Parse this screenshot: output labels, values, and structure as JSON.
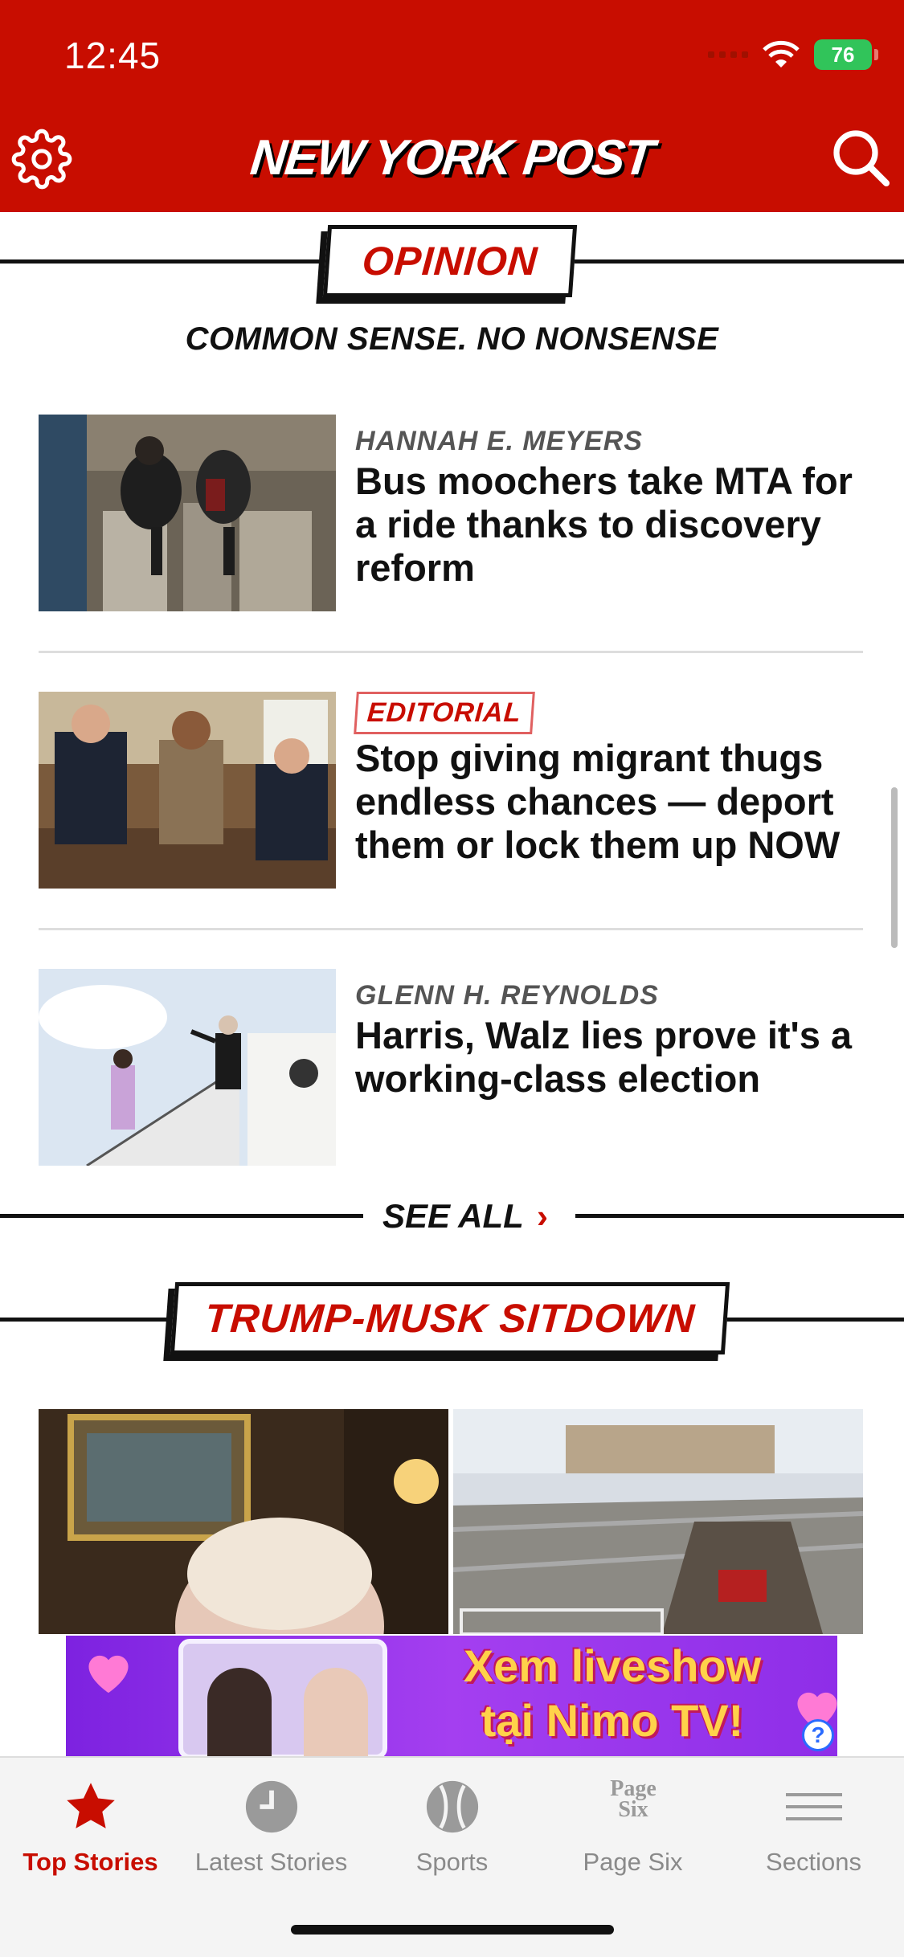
{
  "status_bar": {
    "time": "12:45",
    "battery": "76"
  },
  "header": {
    "logo": "NEW YORK POST",
    "brand_color": "#c80d00"
  },
  "opinion": {
    "title": "OPINION",
    "tagline": "COMMON SENSE. NO NONSENSE",
    "stories": [
      {
        "byline": "HANNAH E. MEYERS",
        "headline": "Bus moochers take MTA for a ride thanks to discovery reform"
      },
      {
        "badge": "EDITORIAL",
        "headline": "Stop giving migrant thugs endless chances — deport them or lock them up NOW"
      },
      {
        "byline": "GLENN H. REYNOLDS",
        "headline": "Harris, Walz lies prove it's a working-class election"
      }
    ],
    "see_all": "SEE ALL"
  },
  "trump_musk": {
    "title": "TRUMP-MUSK SITDOWN"
  },
  "ad": {
    "text_line1": "Xem liveshow",
    "text_line2": "tại Nimo TV!",
    "help": "?"
  },
  "tabbar": {
    "tabs": [
      {
        "label": "Top Stories",
        "icon": "star-icon",
        "active": true
      },
      {
        "label": "Latest Stories",
        "icon": "clock-icon"
      },
      {
        "label": "Sports",
        "icon": "baseball-icon"
      },
      {
        "label": "Page Six",
        "icon": "page-six-icon",
        "icon_text_1": "Page",
        "icon_text_2": "Six"
      },
      {
        "label": "Sections",
        "icon": "menu-icon"
      }
    ]
  }
}
